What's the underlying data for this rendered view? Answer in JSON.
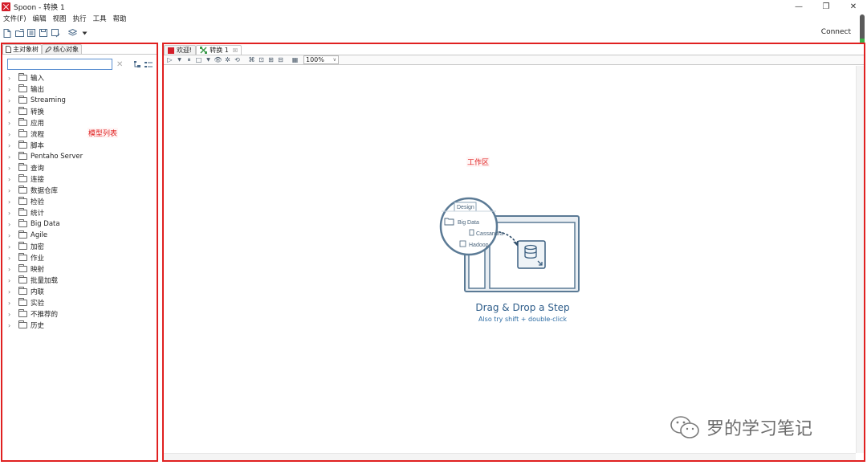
{
  "window": {
    "title": "Spoon - 转换 1",
    "minimize": "—",
    "maximize": "❐",
    "close": "✕"
  },
  "menu": [
    "文件(F)",
    "编辑",
    "视图",
    "执行",
    "工具",
    "帮助"
  ],
  "toolbar": {
    "connect_label": "Connect"
  },
  "left_panel": {
    "tabs": [
      "主对象树",
      "核心对象"
    ],
    "search_value": "",
    "annotation": "模型列表",
    "tree_items": [
      "输入",
      "输出",
      "Streaming",
      "转换",
      "应用",
      "流程",
      "脚本",
      "Pentaho Server",
      "查询",
      "连接",
      "数据仓库",
      "检验",
      "统计",
      "Big Data",
      "Agile",
      "加密",
      "作业",
      "映射",
      "批量加载",
      "内联",
      "实验",
      "不推荐的",
      "历史"
    ]
  },
  "work_area": {
    "tabs": [
      {
        "label": "欢迎!",
        "active": false
      },
      {
        "label": "转换 1",
        "active": true
      }
    ],
    "zoom": "100%",
    "annotation": "工作区",
    "illustration": {
      "design_tab": "Design",
      "big_data": "Big Data",
      "cassandra": "Cassandra",
      "hadoop": "Hadoop"
    },
    "drag_drop_title": "Drag & Drop a Step",
    "drag_drop_hint": "Also try shift + double-click"
  },
  "watermark": "罗的学习笔记",
  "colors": {
    "highlight_border": "#e02020",
    "accent_blue": "#2e5d8a",
    "brand_red": "#d41e2a"
  }
}
